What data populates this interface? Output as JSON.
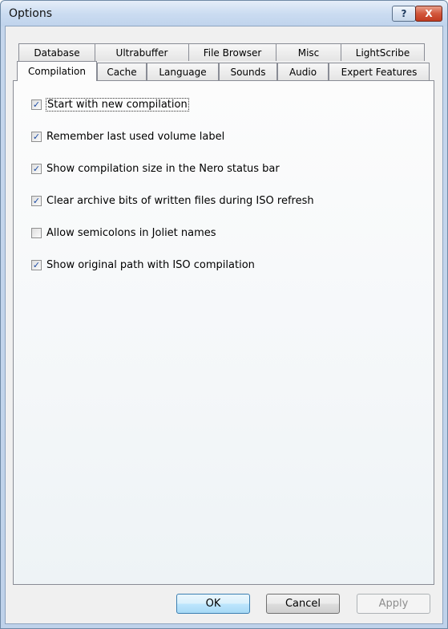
{
  "window": {
    "title": "Options"
  },
  "titlebar": {
    "help_label": "?",
    "close_label": "X"
  },
  "tabs_back": [
    "Database",
    "Ultrabuffer",
    "File Browser",
    "Misc",
    "LightScribe"
  ],
  "tabs_front": [
    "Compilation",
    "Cache",
    "Language",
    "Sounds",
    "Audio",
    "Expert Features"
  ],
  "active_tab": "Compilation",
  "options": [
    {
      "label": "Start with new compilation",
      "checked": true
    },
    {
      "label": "Remember last used volume label",
      "checked": true
    },
    {
      "label": "Show compilation size in the Nero status bar",
      "checked": true
    },
    {
      "label": "Clear archive bits of written files during ISO refresh",
      "checked": true
    },
    {
      "label": "Allow semicolons in Joliet names",
      "checked": false
    },
    {
      "label": "Show original path with ISO compilation",
      "checked": true
    }
  ],
  "buttons": {
    "ok": "OK",
    "cancel": "Cancel",
    "apply": "Apply"
  },
  "colors": {
    "accent": "#3c7fb1",
    "checkmark": "#1b4aa3",
    "close": "#c23b20"
  }
}
